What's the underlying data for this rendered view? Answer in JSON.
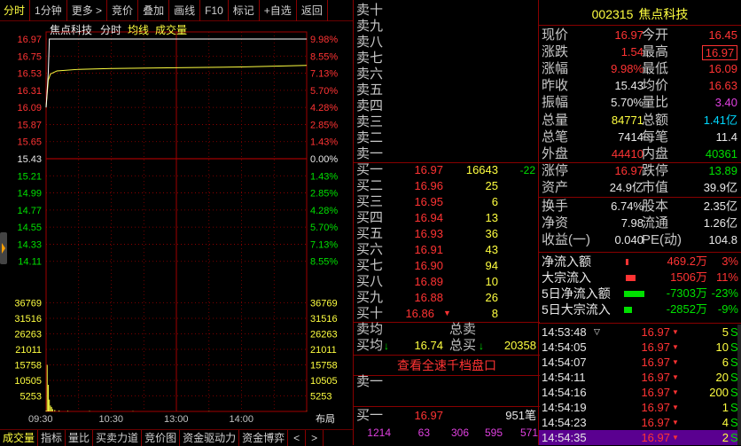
{
  "toolbar": [
    "分时",
    "1分钟",
    "更多 >",
    "竞价",
    "叠加",
    "画线",
    "F10",
    "标记",
    "+自选",
    "返回"
  ],
  "chart_header": {
    "name": "焦点科技",
    "mode": "分时",
    "avg_label": "均线",
    "vol_label": "成交量"
  },
  "chart_data": {
    "type": "line",
    "price_ticks": [
      "16.97",
      "16.75",
      "16.53",
      "16.31",
      "16.09",
      "15.87",
      "15.65",
      "15.43",
      "15.21",
      "14.99",
      "14.77",
      "14.55",
      "14.33",
      "14.11"
    ],
    "pct_ticks": [
      "9.98%",
      "8.55%",
      "7.13%",
      "5.70%",
      "4.28%",
      "2.85%",
      "1.43%",
      "0.00%",
      "1.43%",
      "2.85%",
      "4.28%",
      "5.70%",
      "7.13%",
      "8.55%"
    ],
    "vol_ticks": [
      "36769",
      "31516",
      "26263",
      "21011",
      "15758",
      "10505",
      "5253"
    ],
    "time_ticks": [
      "09:30",
      "10:30",
      "13:00",
      "14:00"
    ],
    "layout_label": "布局",
    "prev_close": 15.43,
    "ylim": [
      13.89,
      16.97
    ],
    "price_series": [
      [
        0,
        16.09
      ],
      [
        1,
        16.31
      ],
      [
        2,
        16.53
      ],
      [
        3,
        16.97
      ],
      [
        4,
        16.97
      ],
      [
        60,
        16.97
      ],
      [
        120,
        16.97
      ],
      [
        180,
        16.97
      ],
      [
        240,
        16.97
      ]
    ],
    "avg_series": [
      [
        0,
        16.09
      ],
      [
        2,
        16.44
      ],
      [
        4,
        16.52
      ],
      [
        10,
        16.56
      ],
      [
        30,
        16.58
      ],
      [
        60,
        16.59
      ],
      [
        120,
        16.6
      ],
      [
        180,
        16.61
      ],
      [
        240,
        16.63
      ]
    ],
    "volume_series": [
      [
        0,
        300
      ],
      [
        1,
        15758
      ],
      [
        2,
        9000
      ],
      [
        3,
        4000
      ],
      [
        4,
        2000
      ],
      [
        5,
        1500
      ],
      [
        6,
        800
      ],
      [
        8,
        500
      ],
      [
        12,
        300
      ],
      [
        20,
        200
      ],
      [
        40,
        150
      ],
      [
        80,
        120
      ],
      [
        150,
        100
      ],
      [
        240,
        90
      ]
    ],
    "vol_max": 42022
  },
  "bottom_tabs": [
    "成交量",
    "指标",
    "量比",
    "买卖力道",
    "竞价图",
    "资金驱动力",
    "资金博弈"
  ],
  "pager": [
    "<",
    ">"
  ],
  "sell_rows": [
    {
      "label": "卖十"
    },
    {
      "label": "卖九"
    },
    {
      "label": "卖八"
    },
    {
      "label": "卖七"
    },
    {
      "label": "卖六"
    },
    {
      "label": "卖五"
    },
    {
      "label": "卖四"
    },
    {
      "label": "卖三"
    },
    {
      "label": "卖二"
    },
    {
      "label": "卖一"
    }
  ],
  "buy_rows": [
    {
      "label": "买一",
      "price": "16.97",
      "vol": "16643",
      "chg": "-22"
    },
    {
      "label": "买二",
      "price": "16.96",
      "vol": "25",
      "chg": ""
    },
    {
      "label": "买三",
      "price": "16.95",
      "vol": "6",
      "chg": ""
    },
    {
      "label": "买四",
      "price": "16.94",
      "vol": "13",
      "chg": ""
    },
    {
      "label": "买五",
      "price": "16.93",
      "vol": "36",
      "chg": ""
    },
    {
      "label": "买六",
      "price": "16.91",
      "vol": "43",
      "chg": ""
    },
    {
      "label": "买七",
      "price": "16.90",
      "vol": "94",
      "chg": ""
    },
    {
      "label": "买八",
      "price": "16.89",
      "vol": "10",
      "chg": ""
    },
    {
      "label": "买九",
      "price": "16.88",
      "vol": "26",
      "chg": ""
    },
    {
      "label": "买十",
      "price": "16.86",
      "vol": "8",
      "chg": ""
    }
  ],
  "sell_avg": {
    "label": "卖均",
    "total_label": "总卖"
  },
  "buy_avg": {
    "label": "买均",
    "price": "16.74",
    "total_label": "总买",
    "total": "20358"
  },
  "full_book_link": "查看全速千档盘口",
  "level2": {
    "sell_label": "卖一",
    "buy_label": "买一",
    "buy_price": "16.97",
    "buy_count": "951笔",
    "queue": [
      "1214",
      "63",
      "306",
      "595",
      "571"
    ]
  },
  "stock": {
    "code": "002315",
    "name": "焦点科技"
  },
  "quote_rows": [
    {
      "l1": "现价",
      "v1": "16.97",
      "c1": "red",
      "l2": "今开",
      "v2": "16.45",
      "c2": "red"
    },
    {
      "l1": "涨跌",
      "v1": "1.54",
      "c1": "red",
      "l2": "最高",
      "v2": "16.97",
      "c2": "red"
    },
    {
      "l1": "涨幅",
      "v1": "9.98%",
      "c1": "red",
      "l2": "最低",
      "v2": "16.09",
      "c2": "red"
    },
    {
      "l1": "昨收",
      "v1": "15.43",
      "c1": "wht",
      "l2": "均价",
      "v2": "16.63",
      "c2": "red"
    },
    {
      "l1": "振幅",
      "v1": "5.70%",
      "c1": "wht",
      "l2": "量比",
      "v2": "3.40",
      "c2": "mag"
    },
    {
      "l1": "总量",
      "v1": "84771",
      "c1": "yel",
      "l2": "总额",
      "v2": "1.41亿",
      "c2": "cyn"
    },
    {
      "l1": "总笔",
      "v1": "7414",
      "c1": "wht",
      "l2": "每笔",
      "v2": "11.4",
      "c2": "wht"
    },
    {
      "l1": "外盘",
      "v1": "44410",
      "c1": "red",
      "l2": "内盘",
      "v2": "40361",
      "c2": "grn"
    }
  ],
  "quote_rows2": [
    {
      "l1": "涨停",
      "v1": "16.97",
      "c1": "red",
      "l2": "跌停",
      "v2": "13.89",
      "c2": "grn"
    },
    {
      "l1": "资产",
      "v1": "24.9亿",
      "c1": "wht",
      "l2": "市值",
      "v2": "39.9亿",
      "c2": "wht"
    }
  ],
  "quote_rows3": [
    {
      "l1": "换手",
      "v1": "6.74%",
      "c1": "wht",
      "l2": "股本",
      "v2": "2.35亿",
      "c2": "wht"
    },
    {
      "l1": "净资",
      "v1": "7.98",
      "c1": "wht",
      "l2": "流通",
      "v2": "1.26亿",
      "c2": "wht"
    },
    {
      "l1": "收益(一)",
      "v1": "0.040",
      "c1": "wht",
      "l2": "PE(动)",
      "v2": "104.8",
      "c2": "wht"
    }
  ],
  "fund_flow": [
    {
      "label": "净流入额",
      "value": "469.2万",
      "pct": "3%",
      "color": "red",
      "bar": 0.03
    },
    {
      "label": "大宗流入",
      "value": "1506万",
      "pct": "11%",
      "color": "red",
      "bar": 0.11
    },
    {
      "label": "5日净流入额",
      "value": "-7303万",
      "pct": "-23%",
      "color": "grn",
      "bar": 0.23
    },
    {
      "label": "5日大宗流入",
      "value": "-2852万",
      "pct": "-9%",
      "color": "grn",
      "bar": 0.09
    }
  ],
  "ticks": [
    {
      "time": "14:53:48",
      "price": "16.97",
      "vol": "5",
      "side": "S"
    },
    {
      "time": "14:54:05",
      "price": "16.97",
      "vol": "10",
      "side": "S"
    },
    {
      "time": "14:54:07",
      "price": "16.97",
      "vol": "6",
      "side": "S"
    },
    {
      "time": "14:54:11",
      "price": "16.97",
      "vol": "20",
      "side": "S"
    },
    {
      "time": "14:54:16",
      "price": "16.97",
      "vol": "200",
      "side": "S"
    },
    {
      "time": "14:54:19",
      "price": "16.97",
      "vol": "1",
      "side": "S"
    },
    {
      "time": "14:54:23",
      "price": "16.97",
      "vol": "4",
      "side": "S"
    },
    {
      "time": "14:54:35",
      "price": "16.97",
      "vol": "2",
      "side": "S"
    }
  ]
}
